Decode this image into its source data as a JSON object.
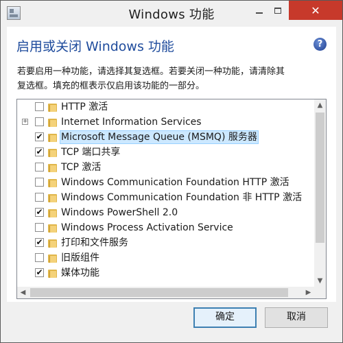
{
  "window": {
    "title": "Windows 功能",
    "close_glyph": "✕"
  },
  "content": {
    "heading": "启用或关闭 Windows 功能",
    "help_glyph": "?",
    "description_line1": "若要启用一种功能，请选择其复选框。若要关闭一种功能，请清除其",
    "description_line2": "复选框。填充的框表示仅启用该功能的一部分。"
  },
  "features": [
    {
      "label": "HTTP 激活",
      "checked": false,
      "expander": false,
      "selected": false
    },
    {
      "label": "Internet Information Services",
      "checked": false,
      "expander": true,
      "selected": false
    },
    {
      "label": "Microsoft Message Queue (MSMQ) 服务器",
      "checked": true,
      "expander": false,
      "selected": true
    },
    {
      "label": "TCP 端口共享",
      "checked": true,
      "expander": false,
      "selected": false
    },
    {
      "label": "TCP 激活",
      "checked": false,
      "expander": false,
      "selected": false
    },
    {
      "label": "Windows Communication Foundation HTTP 激活",
      "checked": false,
      "expander": false,
      "selected": false
    },
    {
      "label": "Windows Communication Foundation 非 HTTP 激活",
      "checked": false,
      "expander": false,
      "selected": false
    },
    {
      "label": "Windows PowerShell 2.0",
      "checked": true,
      "expander": false,
      "selected": false
    },
    {
      "label": "Windows Process Activation Service",
      "checked": false,
      "expander": false,
      "selected": false
    },
    {
      "label": "打印和文件服务",
      "checked": true,
      "expander": false,
      "selected": false
    },
    {
      "label": "旧版组件",
      "checked": false,
      "expander": false,
      "selected": false
    },
    {
      "label": "媒体功能",
      "checked": true,
      "expander": false,
      "selected": false
    }
  ],
  "buttons": {
    "ok": "确定",
    "cancel": "取消"
  },
  "icons": {
    "check_glyph": "✔",
    "expander_glyph": "+",
    "scroll_up_glyph": "▲",
    "scroll_down_glyph": "▼",
    "scroll_left_glyph": "◀",
    "scroll_right_glyph": "▶"
  },
  "colors": {
    "heading": "#1e4b9c",
    "close_button": "#c7392b",
    "selection": "#cce8ff"
  }
}
